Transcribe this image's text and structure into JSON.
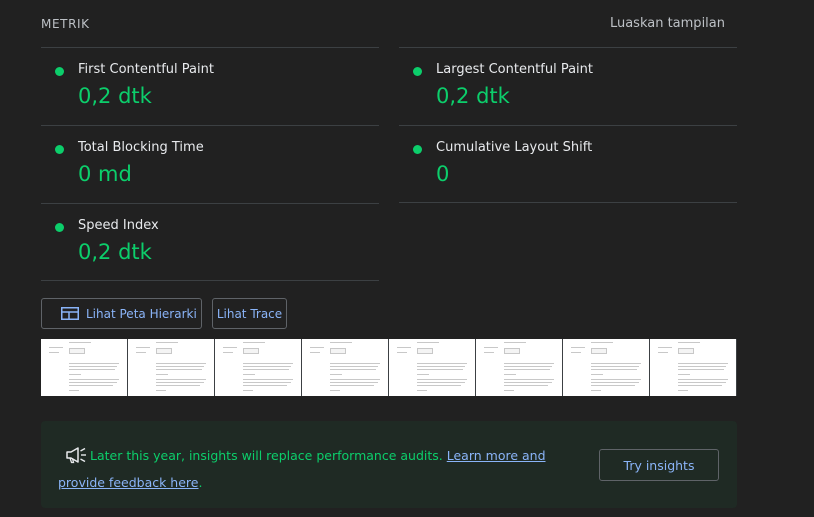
{
  "metrics": {
    "title": "METRIK",
    "expand_label": "Luaskan tampilan",
    "status_color": "#0cce6b",
    "items": [
      {
        "label": "First Contentful Paint",
        "value": "0,2 dtk"
      },
      {
        "label": "Largest Contentful Paint",
        "value": "0,2 dtk"
      },
      {
        "label": "Total Blocking Time",
        "value": "0 md"
      },
      {
        "label": "Cumulative Layout Shift",
        "value": "0"
      },
      {
        "label": "Speed Index",
        "value": "0,2 dtk"
      }
    ]
  },
  "actions": {
    "treemap_label": "Lihat Peta Hierarki",
    "treemap_icon": "treemap-icon",
    "trace_label": "Lihat Trace"
  },
  "filmstrip": {
    "frame_count": 8
  },
  "notice": {
    "icon": "megaphone-icon",
    "text": "Later this year, insights will replace performance audits.",
    "link_text": "Learn more and provide feedback here",
    "suffix": ".",
    "button_label": "Try insights"
  }
}
